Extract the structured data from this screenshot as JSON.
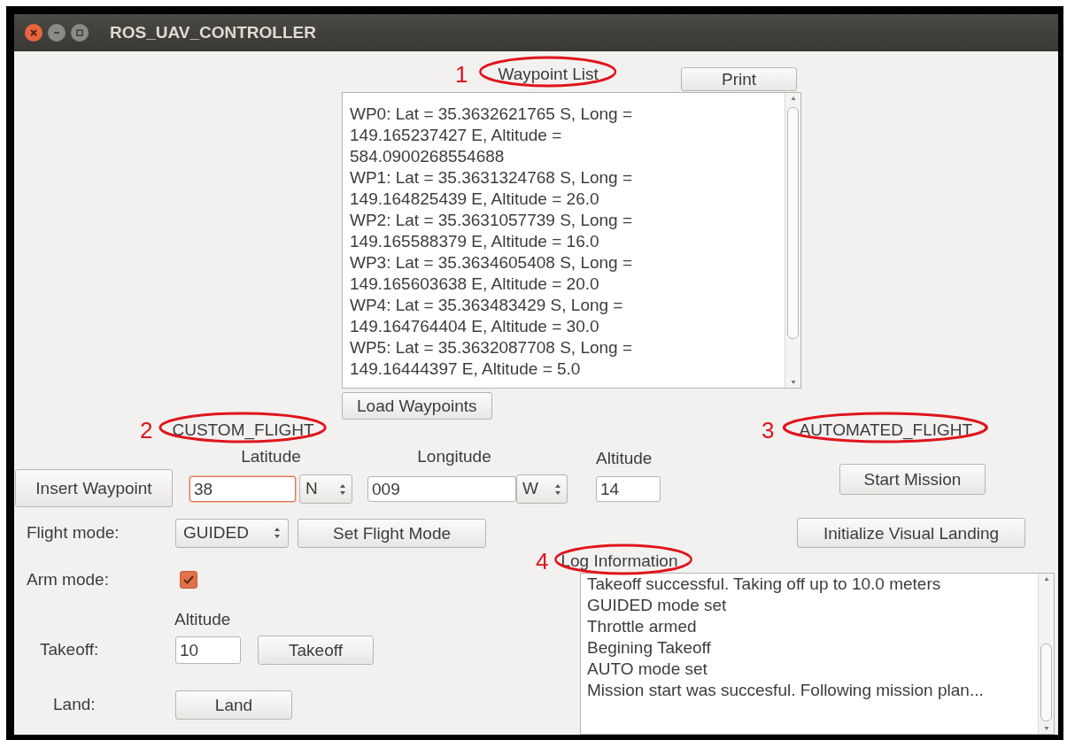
{
  "window": {
    "title": "ROS_UAV_CONTROLLER"
  },
  "waypoint_list": {
    "label": "Waypoint List",
    "annotation": "1",
    "print_button": "Print",
    "load_button": "Load Waypoints",
    "entries": [
      "WP0: Lat = 35.3632621765 S, Long = 149.165237427 E, Altitude = 584.0900268554688",
      "WP1: Lat = 35.3631324768 S, Long = 149.164825439 E, Altitude = 26.0",
      "WP2: Lat = 35.3631057739 S, Long = 149.165588379 E, Altitude = 16.0",
      "WP3: Lat = 35.3634605408 S, Long = 149.165603638 E, Altitude = 20.0",
      "WP4: Lat = 35.363483429 S, Long = 149.164764404 E, Altitude = 30.0",
      "WP5: Lat = 35.3632087708 S, Long = 149.16444397 E, Altitude = 5.0"
    ]
  },
  "custom_flight": {
    "label": "CUSTOM_FLIGHT",
    "annotation": "2",
    "insert_button": "Insert Waypoint",
    "latitude": {
      "label": "Latitude",
      "value": "38",
      "focused": true,
      "hemisphere": "N"
    },
    "longitude": {
      "label": "Longitude",
      "value": "009",
      "focused": false,
      "hemisphere": "W"
    },
    "altitude": {
      "label": "Altitude",
      "value": "14",
      "focused": false
    },
    "flight_mode": {
      "label": "Flight mode:",
      "value": "GUIDED",
      "button": "Set Flight Mode"
    },
    "arm_mode": {
      "label": "Arm mode:",
      "checked": true
    },
    "takeoff": {
      "label": "Takeoff:",
      "altitude_label": "Altitude",
      "value": "10",
      "button": "Takeoff"
    },
    "land": {
      "label": "Land:",
      "button": "Land"
    }
  },
  "automated_flight": {
    "label": "AUTOMATED_FLIGHT",
    "annotation": "3",
    "buttons": [
      "Start Mission",
      "Initialize Visual Landing"
    ]
  },
  "log": {
    "label": "Log Information",
    "annotation": "4",
    "lines": [
      "Takeoff successful. Taking off up to 10.0 meters",
      "GUIDED mode set",
      "Throttle armed",
      "Begining Takeoff",
      "AUTO mode set",
      "Mission start was succesful. Following mission plan..."
    ]
  }
}
